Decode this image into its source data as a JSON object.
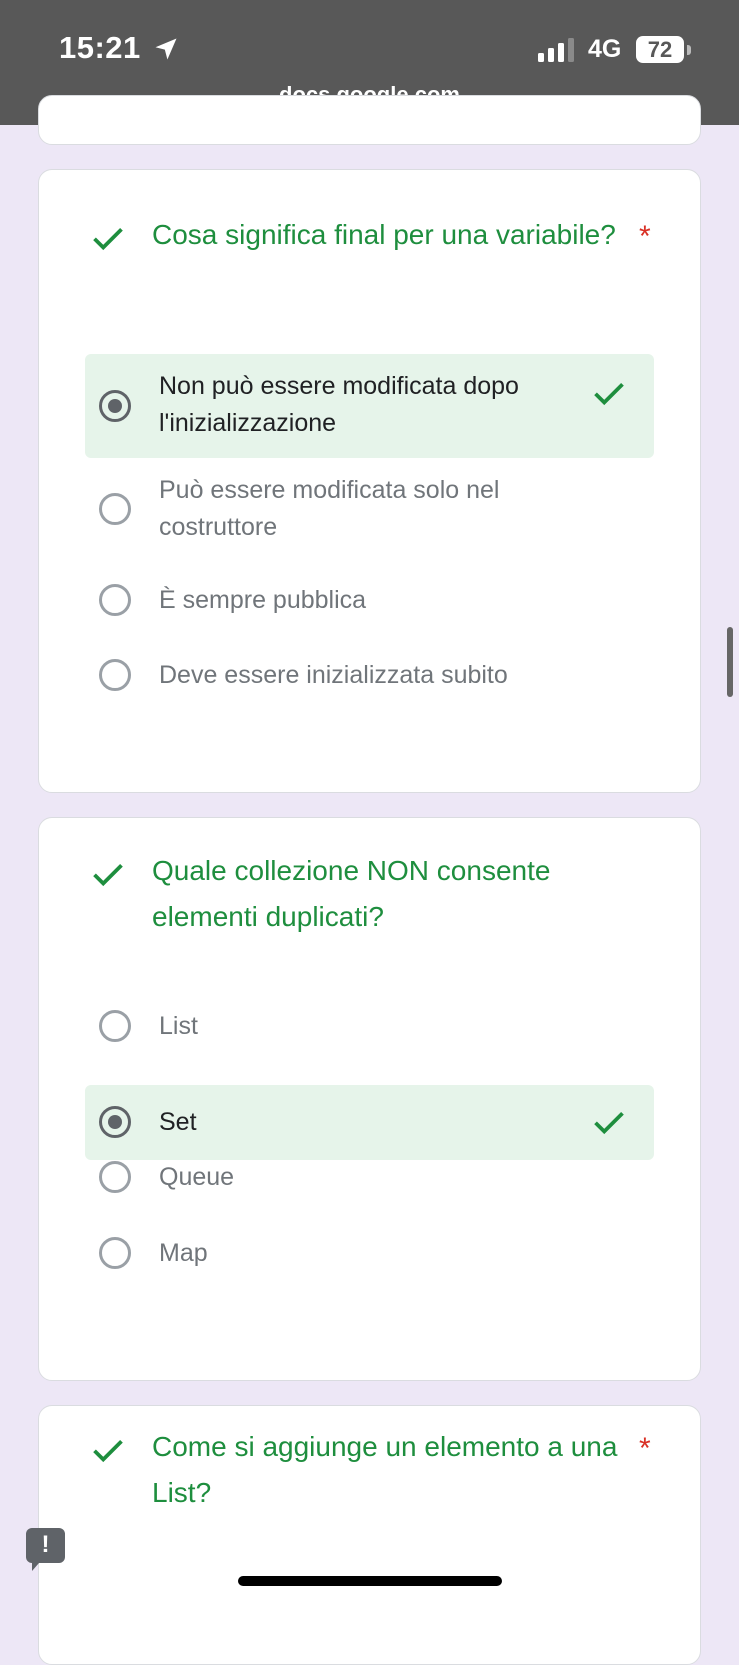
{
  "status_bar": {
    "time": "15:21",
    "network": "4G",
    "battery": "72"
  },
  "browser": {
    "url": "docs.google.com"
  },
  "colors": {
    "correct": "#1e8e3e",
    "required": "#d93025",
    "selected_bg": "#e6f4ea",
    "page_bg": "#ede7f6"
  },
  "questions": [
    {
      "title": "Cosa significa final per una variabile?",
      "required_mark": "*",
      "status_icon": "check-icon",
      "options": [
        {
          "label": "Non può essere modificata dopo l'inizializzazione",
          "selected": true,
          "correct": true
        },
        {
          "label": "Può essere modificata solo nel costruttore",
          "selected": false
        },
        {
          "label": "È sempre pubblica",
          "selected": false
        },
        {
          "label": "Deve essere inizializzata subito",
          "selected": false
        }
      ]
    },
    {
      "title": "Quale collezione NON consente elementi duplicati?",
      "status_icon": "check-icon",
      "options": [
        {
          "label": "List",
          "selected": false
        },
        {
          "label": "Set",
          "selected": true,
          "correct": true
        },
        {
          "label": "Queue",
          "selected": false
        },
        {
          "label": "Map",
          "selected": false
        }
      ]
    },
    {
      "title": "Come si aggiunge un elemento a una List?",
      "required_mark": "*",
      "status_icon": "check-icon"
    }
  ],
  "feedback_button": {
    "label": "!"
  }
}
